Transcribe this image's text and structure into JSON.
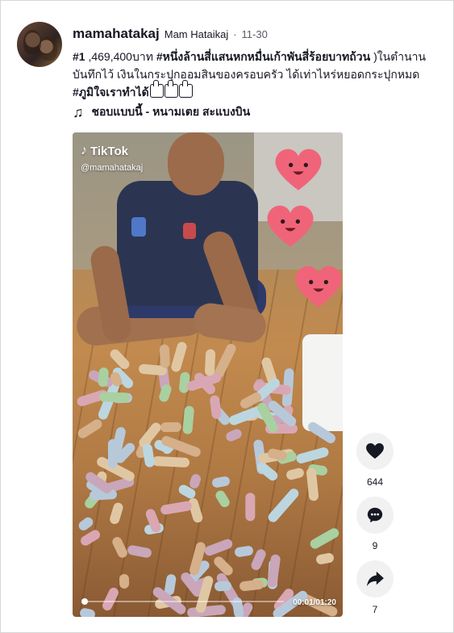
{
  "post": {
    "username": "mamahatakaj",
    "nickname": "Mam Hataikaj",
    "separator": "·",
    "date": "11-30",
    "caption": {
      "tag1": "#1",
      "text1": " ,469,400บาท ",
      "tag2": "#หนึ่งล้านสี่แสนหกหมื่นเก้าพันสี่ร้อยบาทถ้วน",
      "text2": " )ในตำนาน บันทึกไว้ เงินในกระปุกออมสินของครอบครัว ได้เท่าไหร่หยอดกระปุกหมด ",
      "tag3": "#ภูมิใจเราทำได้"
    },
    "music": {
      "icon": "♫",
      "title": "ชอบแบบนี้ - หนามเตย สะแบงบิน"
    }
  },
  "video": {
    "logo_text": "TikTok",
    "watermark_user": "@mamahatakaj",
    "time": "00:01/01:20",
    "progress": 0.01
  },
  "actions": {
    "likes": "644",
    "comments": "9",
    "shares": "7"
  },
  "colors": {
    "text": "#161823",
    "secondary": "#5a5c66",
    "action_bg": "#f1f1f2",
    "heart_pink": "#f0647a"
  }
}
